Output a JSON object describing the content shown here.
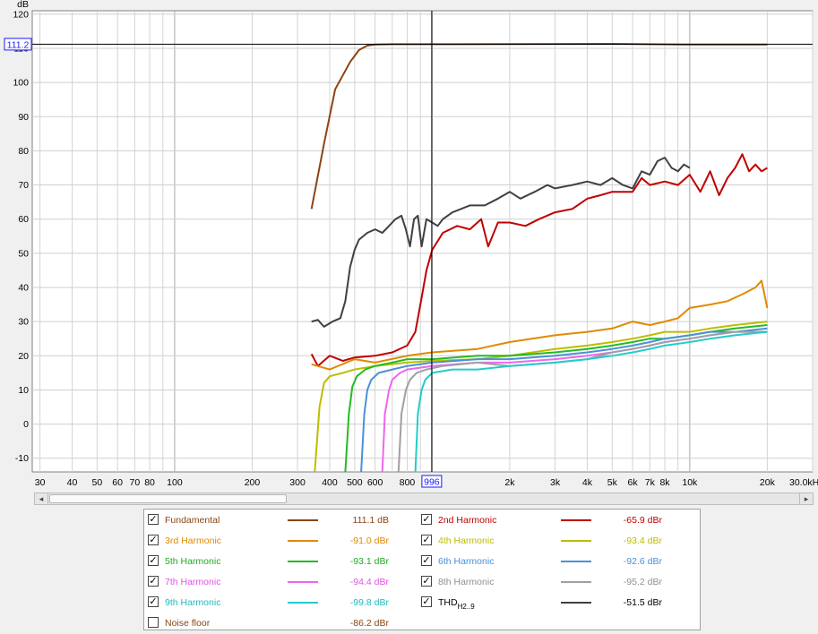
{
  "chart_data": {
    "type": "line",
    "x_scale": "log",
    "xlim": [
      28,
      30000
    ],
    "ylim": [
      -14,
      121
    ],
    "ylabel": "dB",
    "grid": true,
    "y_ticks": [
      -10,
      0,
      10,
      20,
      30,
      40,
      50,
      60,
      70,
      80,
      90,
      100,
      110,
      120
    ],
    "y_tick_labels": [
      "-10",
      "0",
      "10",
      "20",
      "30",
      "40",
      "50",
      "60",
      "70",
      "80",
      "90",
      "100",
      "110",
      "120"
    ],
    "x_ticks": [
      30,
      40,
      50,
      60,
      70,
      80,
      100,
      200,
      300,
      400,
      500,
      600,
      800,
      2000,
      3000,
      4000,
      5000,
      6000,
      7000,
      8000,
      10000,
      20000,
      30000
    ],
    "x_tick_labels": [
      "30",
      "40",
      "50",
      "60",
      "70",
      "80",
      "100",
      "200",
      "300",
      "400",
      "500",
      "600",
      "800",
      "2k",
      "3k",
      "4k",
      "5k",
      "6k",
      "7k",
      "8k",
      "10k",
      "20k",
      "30.0kHz"
    ],
    "cursor": {
      "x": 996,
      "x_label": "996",
      "y": 111.2,
      "y_label": "111.2"
    },
    "series": [
      {
        "name": "Fundamental",
        "color": "#8b4513",
        "x": [
          340,
          380,
          420,
          480,
          520,
          560,
          600,
          700,
          1000,
          5000,
          10000,
          20000
        ],
        "y": [
          63,
          82,
          98,
          106,
          109.5,
          110.8,
          111.1,
          111.2,
          111.2,
          111.3,
          111.1,
          111.1
        ]
      },
      {
        "name": "2nd Harmonic",
        "color": "#c00000",
        "x": [
          340,
          360,
          400,
          450,
          500,
          600,
          700,
          800,
          860,
          900,
          950,
          1000,
          1100,
          1250,
          1400,
          1550,
          1650,
          1800,
          2000,
          2300,
          2600,
          3000,
          3500,
          4000,
          4500,
          5000,
          6000,
          6500,
          7000,
          8000,
          9000,
          10000,
          11000,
          12000,
          13000,
          14000,
          15000,
          16000,
          17000,
          18000,
          19000,
          20000
        ],
        "y": [
          20.5,
          17,
          20,
          18.5,
          19.5,
          20,
          21,
          23,
          27,
          35,
          45,
          51,
          56,
          58,
          57,
          60,
          52,
          59,
          59,
          58,
          60,
          62,
          63,
          66,
          67,
          68,
          68,
          72,
          70,
          71,
          70,
          73,
          68,
          74,
          67,
          72,
          75,
          79,
          74,
          76,
          74,
          75
        ]
      },
      {
        "name": "3rd Harmonic",
        "color": "#e08a00",
        "x": [
          340,
          400,
          500,
          600,
          800,
          1000,
          1500,
          2000,
          3000,
          4000,
          5000,
          6000,
          7000,
          8000,
          9000,
          10000,
          12000,
          14000,
          16000,
          18000,
          19000,
          20000
        ],
        "y": [
          17.5,
          16,
          19,
          18,
          20,
          21,
          22,
          24,
          26,
          27,
          28,
          30,
          29,
          30,
          31,
          34,
          35,
          36,
          38,
          40,
          42,
          34
        ]
      },
      {
        "name": "4th Harmonic",
        "color": "#bdbd00",
        "x": [
          350,
          365,
          380,
          400,
          450,
          500,
          600,
          800,
          1000,
          1500,
          2000,
          3000,
          4000,
          5000,
          6000,
          7000,
          8000,
          10000,
          12000,
          15000,
          20000
        ],
        "y": [
          -14,
          5,
          12,
          14,
          15,
          16,
          17,
          18,
          18.5,
          19,
          20,
          22,
          23,
          24,
          25,
          26,
          27,
          27,
          28,
          29,
          30
        ]
      },
      {
        "name": "5th Harmonic",
        "color": "#22bb22",
        "x": [
          460,
          475,
          490,
          510,
          550,
          600,
          700,
          800,
          1000,
          1500,
          2000,
          3000,
          4000,
          5000,
          6000,
          7000,
          8000,
          10000,
          12000,
          15000,
          20000
        ],
        "y": [
          -14,
          3,
          11,
          14,
          16,
          17,
          18,
          19,
          19,
          20,
          20,
          21,
          22,
          23,
          24,
          25,
          25,
          26,
          27,
          28,
          29
        ]
      },
      {
        "name": "6th Harmonic",
        "color": "#4a90d9",
        "x": [
          530,
          545,
          560,
          580,
          620,
          700,
          800,
          1000,
          1500,
          2000,
          3000,
          4000,
          5000,
          6000,
          7000,
          8000,
          10000,
          12000,
          15000,
          20000
        ],
        "y": [
          -14,
          3,
          10,
          13,
          15,
          16,
          17,
          18,
          19,
          19,
          20,
          21,
          22,
          23,
          24,
          25,
          26,
          27,
          27,
          28
        ]
      },
      {
        "name": "7th Harmonic",
        "color": "#ee66ee",
        "x": [
          640,
          655,
          680,
          700,
          750,
          800,
          1000,
          1500,
          2000,
          3000,
          4000,
          5000,
          6000,
          7000,
          8000,
          10000,
          12000,
          15000,
          20000
        ],
        "y": [
          -14,
          3,
          10,
          13,
          15,
          16,
          17,
          18,
          18,
          19,
          20,
          21,
          22,
          23,
          24,
          25,
          26,
          27,
          27
        ]
      },
      {
        "name": "8th Harmonic",
        "color": "#a0a0a0",
        "x": [
          740,
          760,
          790,
          820,
          870,
          950,
          1100,
          1500,
          2000,
          3000,
          4000,
          5000,
          6000,
          7000,
          8000,
          10000,
          12000,
          15000,
          20000
        ],
        "y": [
          -14,
          3,
          10,
          13,
          15,
          16,
          17,
          18,
          17,
          18,
          19,
          21,
          22,
          23,
          24,
          25,
          26,
          27,
          27
        ]
      },
      {
        "name": "9th Harmonic",
        "color": "#22cccc",
        "x": [
          860,
          880,
          910,
          940,
          1000,
          1200,
          1500,
          2000,
          3000,
          4000,
          5000,
          6000,
          7000,
          8000,
          10000,
          12000,
          15000,
          20000
        ],
        "y": [
          -14,
          3,
          10,
          13,
          15,
          16,
          16,
          17,
          18,
          19,
          20,
          21,
          22,
          23,
          24,
          25,
          26,
          27
        ]
      },
      {
        "name": "THD",
        "color": "#404040",
        "x": [
          340,
          360,
          380,
          410,
          440,
          460,
          480,
          500,
          520,
          560,
          600,
          640,
          680,
          720,
          760,
          790,
          820,
          850,
          880,
          910,
          950,
          1000,
          1050,
          1100,
          1200,
          1400,
          1600,
          1800,
          2000,
          2200,
          2500,
          2800,
          3000,
          3500,
          4000,
          4500,
          5000,
          5500,
          6000,
          6500,
          7000,
          7500,
          8000,
          8500,
          9000,
          9500,
          10000
        ],
        "y": [
          30,
          30.5,
          28.5,
          30,
          31,
          36,
          46,
          51,
          54,
          56,
          57,
          56,
          58,
          60,
          61,
          57,
          52,
          60,
          61,
          52,
          60,
          59,
          58,
          60,
          62,
          64,
          64,
          66,
          68,
          66,
          68,
          70,
          69,
          70,
          71,
          70,
          72,
          70,
          69,
          74,
          73,
          77,
          78,
          75,
          74,
          76,
          75
        ]
      }
    ]
  },
  "axis": {
    "y_unit_label": "dB"
  },
  "legend": {
    "left": [
      {
        "name": "Fundamental",
        "value": "111.1 dB",
        "checked": true,
        "text_color": "#8b4513",
        "value_color": "#8b4513",
        "line_color": "#8b4513"
      },
      {
        "name": "3rd Harmonic",
        "value": "-91.0 dBr",
        "checked": true,
        "text_color": "#e08a00",
        "value_color": "#e08a00",
        "line_color": "#e08a00"
      },
      {
        "name": "5th Harmonic",
        "value": "-93.1 dBr",
        "checked": true,
        "text_color": "#22aa22",
        "value_color": "#22aa22",
        "line_color": "#22bb22"
      },
      {
        "name": "7th Harmonic",
        "value": "-94.4 dBr",
        "checked": true,
        "text_color": "#e055e0",
        "value_color": "#e055e0",
        "line_color": "#ee66ee"
      },
      {
        "name": "9th Harmonic",
        "value": "-99.8 dBr",
        "checked": true,
        "text_color": "#20bbbb",
        "value_color": "#20bbbb",
        "line_color": "#22cccc"
      },
      {
        "name": "Noise floor",
        "value": "-86.2 dBr",
        "checked": false,
        "text_color": "#8b4513",
        "value_color": "#8b4513",
        "line_color": ""
      }
    ],
    "right": [
      {
        "name": "2nd Harmonic",
        "value": "-65.9 dBr",
        "checked": true,
        "text_color": "#c00000",
        "value_color": "#c00000",
        "line_color": "#c00000"
      },
      {
        "name": "4th Harmonic",
        "value": "-93.4 dBr",
        "checked": true,
        "text_color": "#bdbd00",
        "value_color": "#bdbd00",
        "line_color": "#bdbd00"
      },
      {
        "name": "6th Harmonic",
        "value": "-92.6 dBr",
        "checked": true,
        "text_color": "#4a90d9",
        "value_color": "#4a90d9",
        "line_color": "#4a90d9"
      },
      {
        "name": "8th Harmonic",
        "value": "-95.2 dBr",
        "checked": true,
        "text_color": "#909090",
        "value_color": "#909090",
        "line_color": "#a0a0a0"
      },
      {
        "name": "THD",
        "name_sub": "H2..9",
        "value": "-51.5 dBr",
        "checked": true,
        "text_color": "#000000",
        "value_color": "#000000",
        "line_color": "#404040"
      }
    ]
  },
  "scrollbar": {
    "left_arrow": "◂",
    "right_arrow": "▸"
  }
}
